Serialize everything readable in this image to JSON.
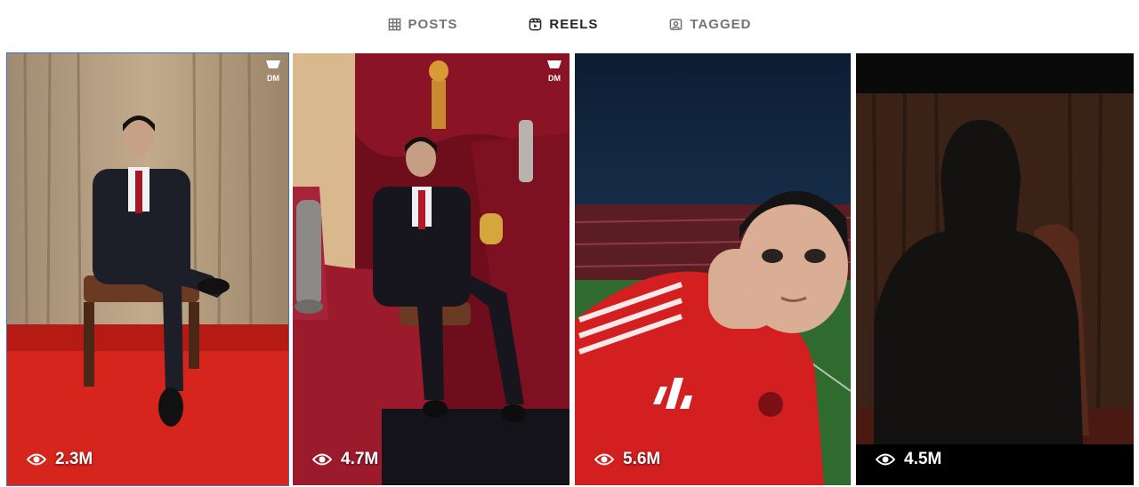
{
  "tabs": [
    {
      "label": "POSTS",
      "icon": "grid-icon",
      "active": false
    },
    {
      "label": "REELS",
      "icon": "reels-icon",
      "active": true
    },
    {
      "label": "TAGGED",
      "icon": "tagged-icon",
      "active": false
    }
  ],
  "reels": [
    {
      "views": "2.3M",
      "badge": "DM",
      "selected": true
    },
    {
      "views": "4.7M",
      "badge": "DM",
      "selected": false
    },
    {
      "views": "5.6M",
      "badge": "",
      "selected": false
    },
    {
      "views": "4.5M",
      "badge": "",
      "selected": false
    }
  ],
  "colors": {
    "active_tab": "#262626",
    "inactive_tab": "#737373",
    "selection": "#3b6fd6"
  }
}
